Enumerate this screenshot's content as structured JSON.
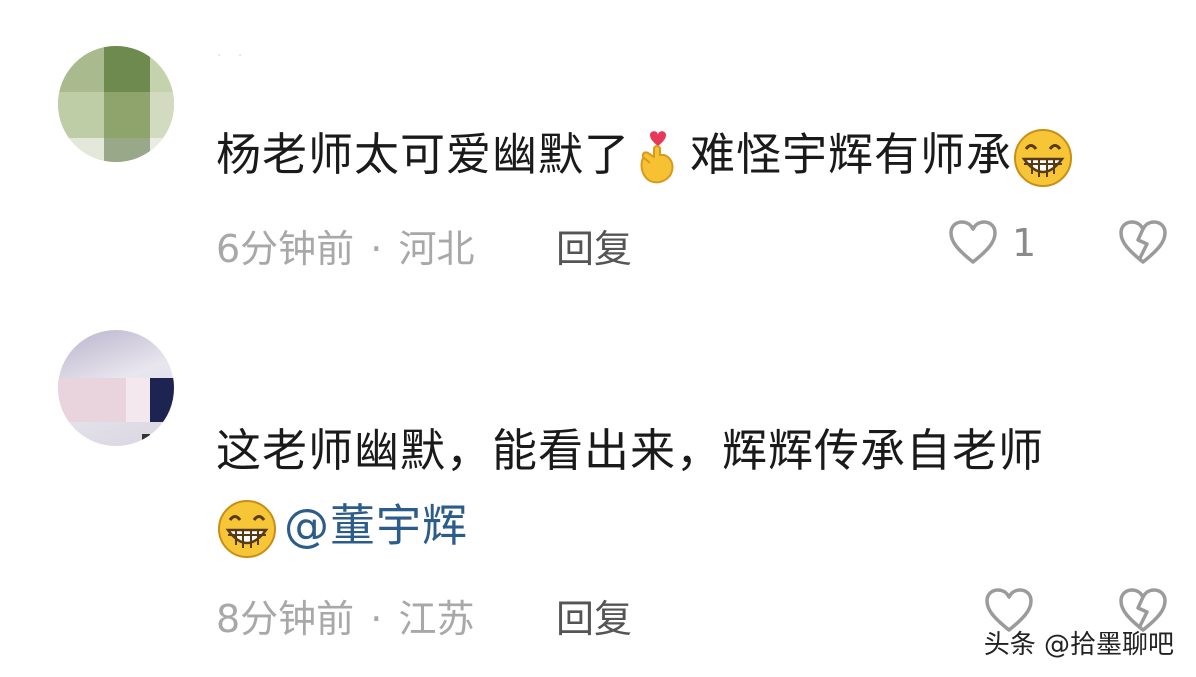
{
  "comments": [
    {
      "text_before_emoji": "杨老师太可爱幽默了",
      "emoji_1": "finger-heart-emoji",
      "text_after_emoji": "难怪宇辉有师承",
      "emoji_2": "grinning-face-emoji",
      "time": "6分钟前",
      "separator": "·",
      "location": "河北",
      "reply_label": "回复",
      "like_count": "1"
    },
    {
      "text": "这老师幽默，能看出来，辉辉传承自老师",
      "emoji": "grinning-face-emoji",
      "mention": "@董宇辉",
      "time": "8分钟前",
      "separator": "·",
      "location": "江苏",
      "reply_label": "回复",
      "like_count": ""
    }
  ],
  "watermark": "头条 @拾墨聊吧",
  "colors": {
    "text": "#1a1a1a",
    "meta": "#a8a8a8",
    "mention": "#2b5c8a",
    "icon": "#9b9b9b"
  }
}
